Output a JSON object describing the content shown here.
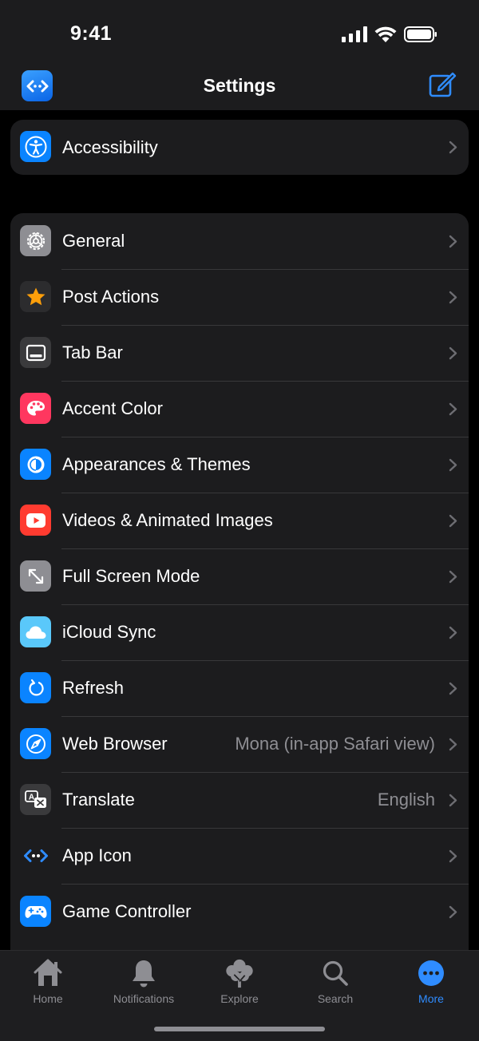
{
  "status": {
    "time": "9:41"
  },
  "nav": {
    "title": "Settings"
  },
  "group1": [
    {
      "label": "Accessibility",
      "icon": "accessibility-icon",
      "color": "#0a84ff"
    }
  ],
  "group2": [
    {
      "label": "General",
      "value": "",
      "icon": "gear-icon",
      "color": "#8e8e93"
    },
    {
      "label": "Post Actions",
      "value": "",
      "icon": "star-icon",
      "color": "#2c2c2e"
    },
    {
      "label": "Tab Bar",
      "value": "",
      "icon": "tab-bar-icon",
      "color": "#3a3a3c"
    },
    {
      "label": "Accent Color",
      "value": "",
      "icon": "palette-icon",
      "color": "#ff375f"
    },
    {
      "label": "Appearances & Themes",
      "value": "",
      "icon": "appearance-icon",
      "color": "#0a84ff"
    },
    {
      "label": "Videos & Animated Images",
      "value": "",
      "icon": "play-icon",
      "color": "#ff3b30"
    },
    {
      "label": "Full Screen Mode",
      "value": "",
      "icon": "fullscreen-icon",
      "color": "#8e8e93"
    },
    {
      "label": "iCloud Sync",
      "value": "",
      "icon": "cloud-icon",
      "color": "#5ac8fa"
    },
    {
      "label": "Refresh",
      "value": "",
      "icon": "refresh-icon",
      "color": "#0a84ff"
    },
    {
      "label": "Web Browser",
      "value": "Mona (in-app Safari view)",
      "icon": "compass-icon",
      "color": "#0a84ff"
    },
    {
      "label": "Translate",
      "value": "English",
      "icon": "translate-icon",
      "color": "#3a3a3c"
    },
    {
      "label": "App Icon",
      "value": "",
      "icon": "app-icon-icon",
      "color": "#1c1c1e"
    },
    {
      "label": "Game Controller",
      "value": "",
      "icon": "gamecontroller-icon",
      "color": "#0a84ff"
    }
  ],
  "tabs": [
    {
      "label": "Home",
      "icon": "home-icon",
      "active": false
    },
    {
      "label": "Notifications",
      "icon": "bell-icon",
      "active": false
    },
    {
      "label": "Explore",
      "icon": "tree-icon",
      "active": false
    },
    {
      "label": "Search",
      "icon": "search-icon",
      "active": false
    },
    {
      "label": "More",
      "icon": "more-icon",
      "active": true
    }
  ],
  "colors": {
    "accent": "#2f8cff",
    "background": "#000000",
    "cell": "#1c1c1e",
    "secondaryText": "#8e8e93"
  }
}
